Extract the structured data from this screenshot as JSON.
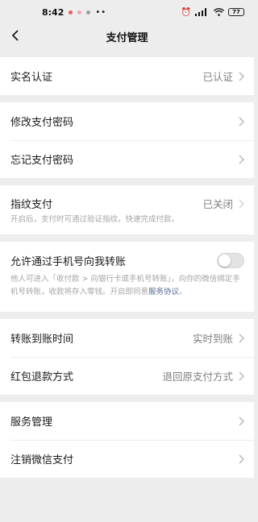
{
  "status_bar": {
    "time": "8:42",
    "battery": "77"
  },
  "nav": {
    "title": "支付管理"
  },
  "real_name": {
    "label": "实名认证",
    "value": "已认证"
  },
  "password": {
    "modify_label": "修改支付密码",
    "forget_label": "忘记支付密码"
  },
  "fingerprint": {
    "label": "指纹支付",
    "value": "已关闭",
    "description": "开启后，支付时可通过验证指纹，快速完成付款。"
  },
  "phone_transfer": {
    "label": "允许通过手机号向我转账",
    "enabled": false,
    "description": "他人可进入「收付款 > 向银行卡或手机号转账」，向你的微信绑定手机号转账，收款将存入零钱。开启即同意",
    "link": "服务协议",
    "end": "。"
  },
  "transfer": {
    "arrival_label": "转账到账时间",
    "arrival_value": "实时到账",
    "refund_label": "红包退款方式",
    "refund_value": "退回原支付方式"
  },
  "service": {
    "manage_label": "服务管理",
    "cancel_label": "注销微信支付"
  }
}
